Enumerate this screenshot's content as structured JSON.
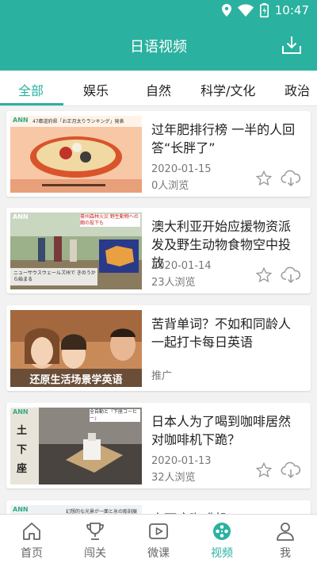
{
  "status": {
    "time": "10:47"
  },
  "header": {
    "title": "日语视频"
  },
  "tabs": [
    {
      "label": "全部"
    },
    {
      "label": "娱乐"
    },
    {
      "label": "自然"
    },
    {
      "label": "科学/文化"
    },
    {
      "label": "政治"
    }
  ],
  "cards": [
    {
      "title": "过年肥排行榜 一半的人回答“长胖了”",
      "date": "2020-01-15",
      "views": "0人浏览",
      "thumb_caption": "47都道府県「お正月太りランキング」発表",
      "thumb_brand": "ANN"
    },
    {
      "title": "澳大利亚开始应援物资派发及野生动物食物空中投放",
      "date": "2020-01-14",
      "views": "23人浏览",
      "thumb_caption": "豪州森林火災 野生動物への餌の投下も",
      "thumb_sub": "ニューサウスウェールズ州で きのうから始まる",
      "thumb_brand": "ANN"
    },
    {
      "title": "苦背单词？不如和同龄人一起打卡每日英语",
      "ad_label": "推广",
      "thumb_caption": "还原生活场景学英语"
    },
    {
      "title": "日本人为了喝到咖啡居然对咖啡机下跪？",
      "date": "2020-01-13",
      "views": "32人浏览",
      "thumb_caption": "全自動と「下座コーヒー」",
      "thumb_brand": "ANN",
      "thumb_side": "土下座"
    },
    {
      "title": "土下座咖啡机",
      "thumb_caption": "幻想的な光景が一面と氷の彫刻展",
      "thumb_brand": "ANN"
    }
  ],
  "bottom_nav": [
    {
      "label": "首页",
      "icon": "home-icon"
    },
    {
      "label": "闯关",
      "icon": "trophy-icon"
    },
    {
      "label": "微课",
      "icon": "play-icon"
    },
    {
      "label": "视频",
      "icon": "film-reel-icon"
    },
    {
      "label": "我",
      "icon": "person-icon"
    }
  ],
  "colors": {
    "accent": "#2bb1a0",
    "background": "#f2f2f2"
  }
}
